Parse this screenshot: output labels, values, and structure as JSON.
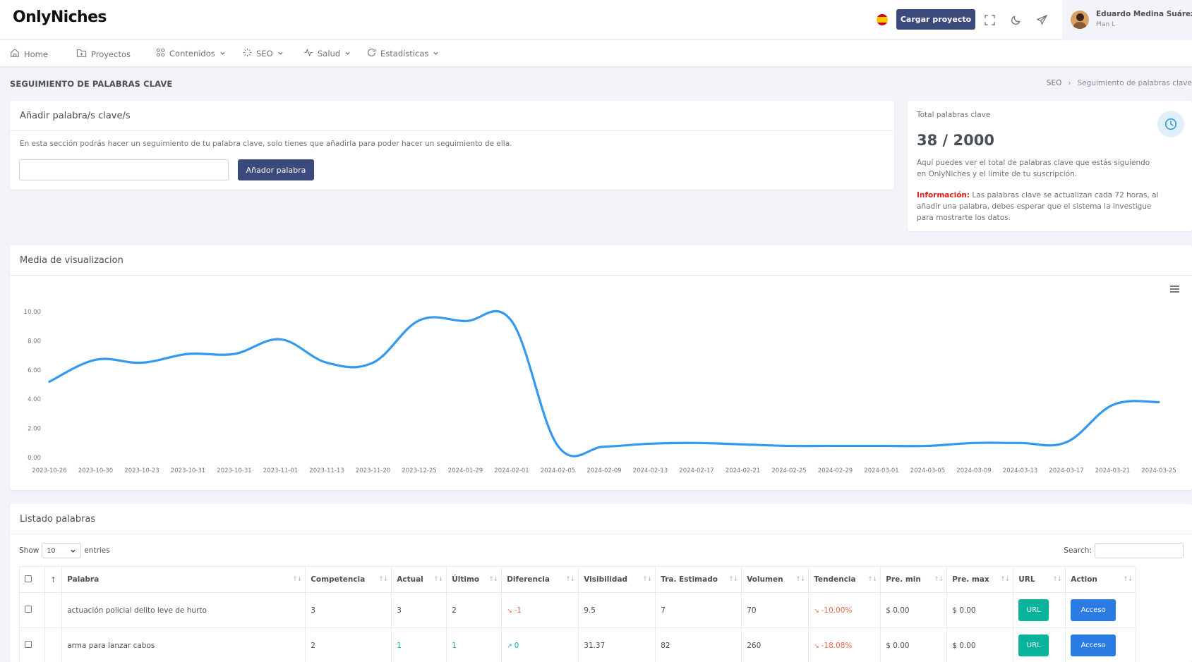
{
  "app": {
    "logo": "OnlyNiches",
    "cta_button": "Cargar proyecto",
    "user": {
      "name": "Eduardo Medina Suárez",
      "plan": "Plan L"
    }
  },
  "nav": [
    {
      "label": "Home",
      "icon": "home-icon",
      "dropdown": false
    },
    {
      "label": "Proyectos",
      "icon": "folder-icon",
      "dropdown": false
    },
    {
      "label": "Contenidos",
      "icon": "grid-icon",
      "dropdown": true
    },
    {
      "label": "SEO",
      "icon": "loader-icon",
      "dropdown": true
    },
    {
      "label": "Salud",
      "icon": "activity-icon",
      "dropdown": true
    },
    {
      "label": "Estadísticas",
      "icon": "refresh-icon",
      "dropdown": true
    }
  ],
  "page": {
    "title": "SEGUIMIENTO DE PALABRAS CLAVE",
    "breadcrumb": [
      "SEO",
      "Seguimiento de palabras clave"
    ]
  },
  "add_card": {
    "title": "Añadir palabra/s clave/s",
    "description": "En esta sección podrás hacer un seguimiento de tu palabra clave, solo tienes que añadirla para poder hacer un seguimiento de ella.",
    "input_value": "",
    "button": "Añador palabra"
  },
  "total_card": {
    "label": "Total palabras clave",
    "value": "38 / 2000",
    "description": "Aquí puedes ver el total de palabras clave que estás siguiendo en OnlyNiches y el límite de tu suscripción.",
    "info_label": "Información:",
    "info_text": " Las palabras clave se actualizan cada 72 horas, al añadir una palabra, debes esperar que el sistema la investigue para mostrarte los datos."
  },
  "chart_card": {
    "title": "Media de visualizacion"
  },
  "chart_data": {
    "type": "line",
    "title": "",
    "xlabel": "",
    "ylabel": "",
    "ylim": [
      0,
      10
    ],
    "yticks": [
      "0.00",
      "2.00",
      "4.00",
      "6.00",
      "8.00",
      "10.00"
    ],
    "categories": [
      "2023-10-26",
      "2023-10-30",
      "2023-10-23",
      "2023-10-31",
      "2023-10-31",
      "2023-11-01",
      "2023-11-13",
      "2023-11-20",
      "2023-12-25",
      "2024-01-29",
      "2024-02-01",
      "2024-02-05",
      "2024-02-09",
      "2024-02-13",
      "2024-02-17",
      "2024-02-21",
      "2024-02-25",
      "2024-02-29",
      "2024-03-01",
      "2024-03-05",
      "2024-03-09",
      "2024-03-13",
      "2024-03-17",
      "2024-03-21",
      "2024-03-25"
    ],
    "series": [
      {
        "values": [
          5.2,
          6.7,
          6.5,
          7.1,
          7.1,
          8.1,
          6.5,
          6.5,
          9.4,
          9.35,
          9.35,
          0.8,
          0.75,
          0.95,
          1.0,
          0.9,
          0.8,
          0.8,
          0.8,
          0.8,
          1.0,
          1.0,
          1.05,
          3.6,
          3.8
        ],
        "color": "#3399ee"
      }
    ],
    "grid": false,
    "legend": "none"
  },
  "list_card": {
    "title": "Listado palabras",
    "show_label": "Show",
    "show_value": "10",
    "entries_label": "entries",
    "search_label": "Search:",
    "columns": [
      "Palabra",
      "Competencia",
      "Actual",
      "Último",
      "Diferencia",
      "Visibilidad",
      "Tra. Estimado",
      "Volumen",
      "Tendencia",
      "Pre. min",
      "Pre. max",
      "URL",
      "Action"
    ],
    "rows": [
      {
        "palabra": "actuación policial delito leve de hurto",
        "competencia": "3",
        "actual": "3",
        "ultimo": "2",
        "diferencia": "-1",
        "visibilidad": "9.5",
        "trafico": "7",
        "volumen": "70",
        "tendencia": "-10.00%",
        "pre_min": "$ 0.00",
        "pre_max": "$ 0.00",
        "url": "URL",
        "action": "Acceso"
      },
      {
        "palabra": "arma para lanzar cabos",
        "competencia": "2",
        "actual": "1",
        "ultimo": "1",
        "diferencia": "0",
        "visibilidad": "31.37",
        "trafico": "82",
        "volumen": "260",
        "tendencia": "-18.08%",
        "pre_min": "$ 0.00",
        "pre_max": "$ 0.00",
        "url": "URL",
        "action": "Acceso"
      }
    ]
  },
  "colors": {
    "primary": "#3b4a7a",
    "line": "#3399ee",
    "success": "#0ab39c",
    "danger": "#f06548",
    "info": "#2b7be4",
    "info_label": "#e0201f"
  }
}
